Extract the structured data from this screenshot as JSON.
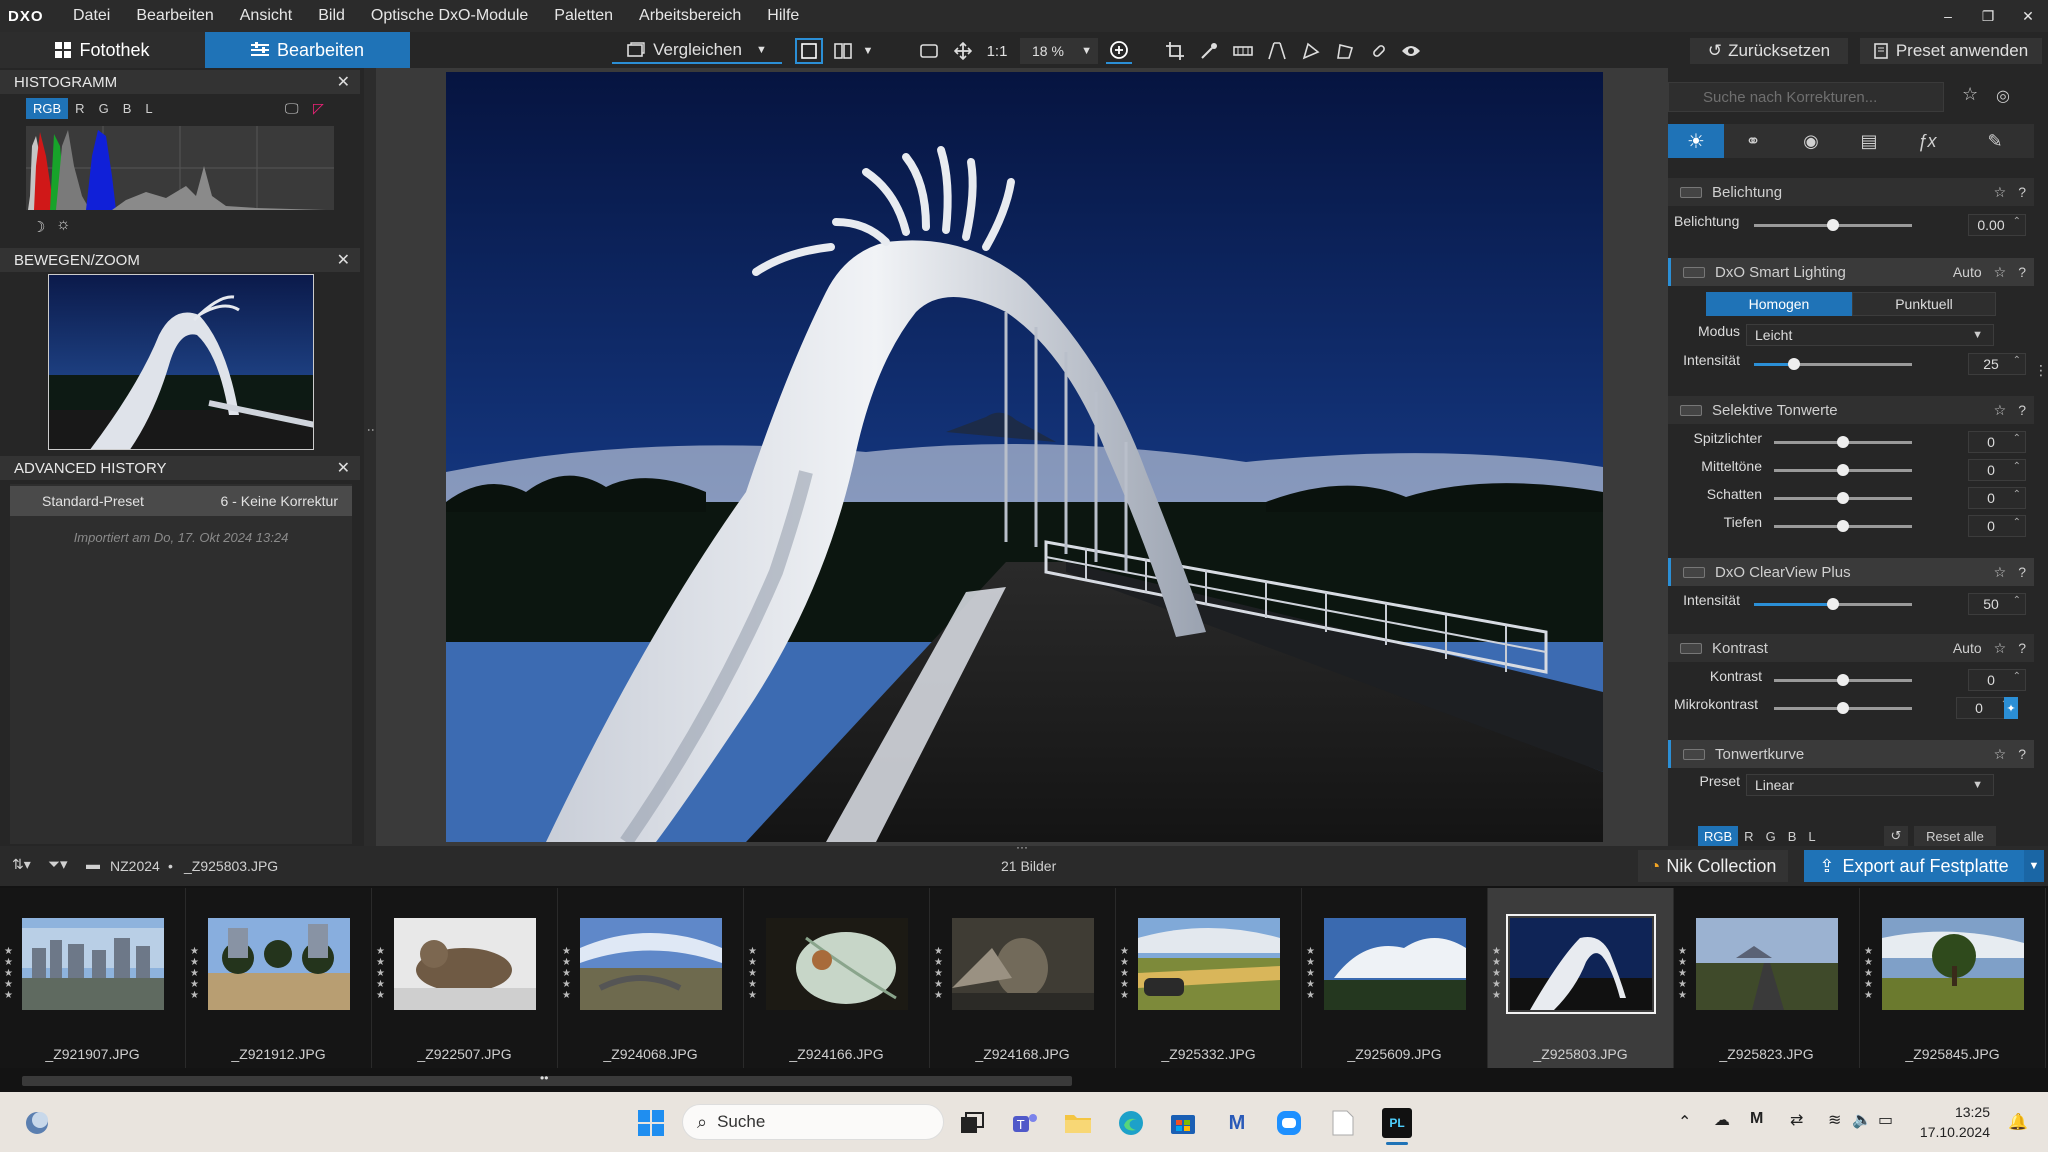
{
  "menu": {
    "logo": "DXO",
    "items": [
      "Datei",
      "Bearbeiten",
      "Ansicht",
      "Bild",
      "Optische DxO-Module",
      "Paletten",
      "Arbeitsbereich",
      "Hilfe"
    ]
  },
  "window_controls": [
    "–",
    "❐",
    "✕"
  ],
  "toolbar": {
    "tab_library": "Fotothek",
    "tab_edit": "Bearbeiten",
    "compare": "Vergleichen",
    "zoom_1to1": "1:1",
    "zoom_value": "18 %",
    "reset": "Zurücksetzen",
    "apply_preset": "Preset anwenden"
  },
  "left": {
    "histogram": {
      "title": "HISTOGRAMM",
      "channels": [
        "RGB",
        "R",
        "G",
        "B",
        "L"
      ]
    },
    "move_zoom": {
      "title": "BEWEGEN/ZOOM"
    },
    "history": {
      "title": "ADVANCED HISTORY",
      "row_left": "Standard-Preset",
      "row_right": "6 - Keine Korrektur",
      "imported": "Importiert am Do, 17. Okt 2024 13:24"
    }
  },
  "right": {
    "search_placeholder": "Suche nach Korrekturen...",
    "sections": {
      "exposure": {
        "title": "Belichtung",
        "label": "Belichtung",
        "value": "0.00",
        "slider": 0.5
      },
      "smart_lighting": {
        "title": "DxO Smart Lighting",
        "auto": "Auto",
        "mode_homogen": "Homogen",
        "mode_punktuell": "Punktuell",
        "modus_label": "Modus",
        "modus_value": "Leicht",
        "intensity_label": "Intensität",
        "intensity_value": "25",
        "slider": 0.25
      },
      "selective": {
        "title": "Selektive Tonwerte",
        "rows": [
          {
            "label": "Spitzlichter",
            "value": "0",
            "slider": 0.5
          },
          {
            "label": "Mitteltöne",
            "value": "0",
            "slider": 0.5
          },
          {
            "label": "Schatten",
            "value": "0",
            "slider": 0.5
          },
          {
            "label": "Tiefen",
            "value": "0",
            "slider": 0.5
          }
        ]
      },
      "clearview": {
        "title": "DxO ClearView Plus",
        "label": "Intensität",
        "value": "50",
        "slider": 0.5
      },
      "contrast": {
        "title": "Kontrast",
        "auto": "Auto",
        "rows": [
          {
            "label": "Kontrast",
            "value": "0",
            "slider": 0.5
          },
          {
            "label": "Mikrokontrast",
            "value": "0",
            "slider": 0.5
          }
        ]
      },
      "tonecurve": {
        "title": "Tonwertkurve",
        "preset_label": "Preset",
        "preset_value": "Linear",
        "channels": [
          "RGB",
          "R",
          "G",
          "B",
          "L"
        ],
        "reset_all": "Reset alle"
      }
    },
    "help": "?"
  },
  "statusbar": {
    "folder": "NZ2024",
    "bullet": "•",
    "file": "_Z925803.JPG",
    "count": "21 Bilder",
    "nik": "Nik Collection",
    "export": "Export auf Festplatte"
  },
  "filmstrip": [
    {
      "name": "_Z921907.JPG"
    },
    {
      "name": "_Z921912.JPG"
    },
    {
      "name": "_Z922507.JPG"
    },
    {
      "name": "_Z924068.JPG"
    },
    {
      "name": "_Z924166.JPG"
    },
    {
      "name": "_Z924168.JPG"
    },
    {
      "name": "_Z925332.JPG"
    },
    {
      "name": "_Z925609.JPG"
    },
    {
      "name": "_Z925803.JPG",
      "selected": true
    },
    {
      "name": "_Z925823.JPG"
    },
    {
      "name": "_Z925845.JPG"
    }
  ],
  "taskbar": {
    "search": "Suche",
    "time": "13:25",
    "date": "17.10.2024"
  },
  "colors": {
    "accent": "#1f73b7",
    "accent_light": "#2b8fd6",
    "bg": "#1e1e1e",
    "panel": "#262626"
  }
}
